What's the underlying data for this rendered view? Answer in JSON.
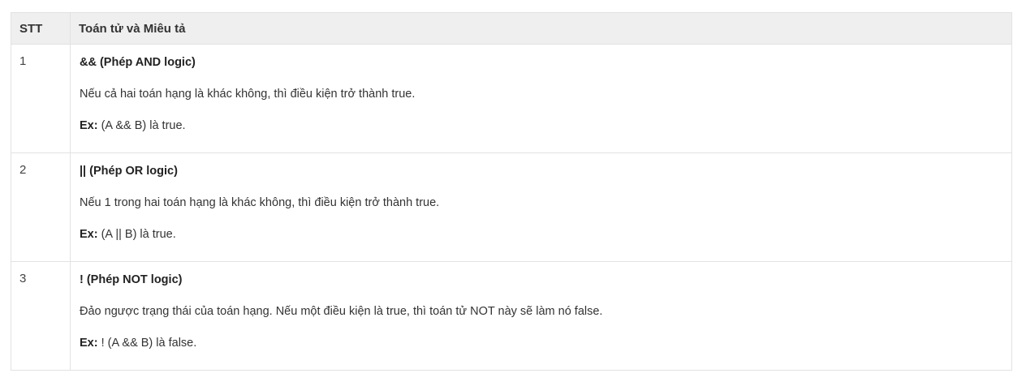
{
  "table": {
    "headers": {
      "stt": "STT",
      "desc": "Toán tử và Miêu tả"
    },
    "rows": [
      {
        "stt": "1",
        "title": "&& (Phép AND logic)",
        "description": "Nếu cả hai toán hạng là khác không, thì điều kiện trở thành true.",
        "ex_label": "Ex:",
        "ex_text": " (A && B) là true."
      },
      {
        "stt": "2",
        "title": "|| (Phép OR logic)",
        "description": "Nếu 1 trong hai toán hạng là khác không, thì điều kiện trở thành true.",
        "ex_label": "Ex:",
        "ex_text": " (A || B) là true."
      },
      {
        "stt": "3",
        "title": "! (Phép NOT logic)",
        "description": "Đảo ngược trạng thái của toán hạng. Nếu một điều kiện là true, thì toán tử NOT này sẽ làm nó false.",
        "ex_label": "Ex:",
        "ex_text": " ! (A && B) là false."
      }
    ]
  }
}
